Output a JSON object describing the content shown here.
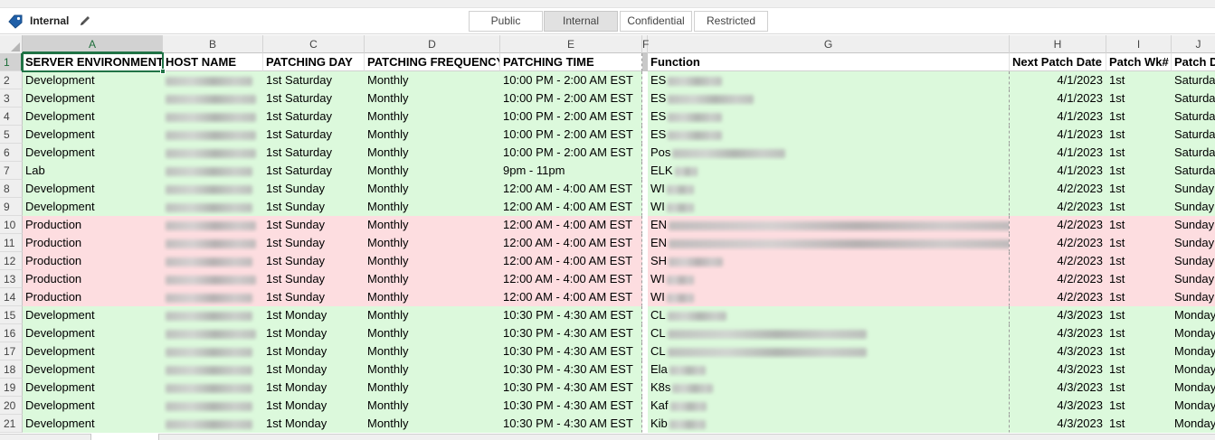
{
  "sensitivity": {
    "current_label": "Internal",
    "icon": "tag-icon",
    "edit_icon": "pencil-icon",
    "options": [
      "Public",
      "Internal",
      "Confidential",
      "Restricted"
    ],
    "selected": "Internal",
    "accent_color": "#1f5fa8"
  },
  "sheet": {
    "selected_cell": "A1",
    "columns": [
      "A",
      "B",
      "C",
      "D",
      "E",
      "F",
      "G",
      "H",
      "I",
      "J"
    ],
    "row_numbers": [
      "1",
      "2",
      "3",
      "4",
      "5",
      "6",
      "7",
      "8",
      "9",
      "10",
      "11",
      "12",
      "13",
      "14",
      "15",
      "16",
      "17",
      "18",
      "19",
      "20",
      "21"
    ],
    "headers": [
      "SERVER ENVIRONMENT",
      "HOST NAME",
      "PATCHING DAY",
      "PATCHING FREQUENCY",
      "PATCHING TIME",
      "",
      "Function",
      "Next Patch Date",
      "Patch Wk#",
      "Patch D"
    ],
    "row_colors": {
      "green": "#dcf9dc",
      "red": "#fddde0"
    },
    "rows": [
      {
        "env": "Development",
        "day": "1st Saturday",
        "freq": "Monthly",
        "time": "10:00 PM - 2:00 AM EST",
        "func": "ES",
        "date": "4/1/2023",
        "wk": "1st",
        "pday": "Saturda",
        "color": "green"
      },
      {
        "env": "Development",
        "day": "1st Saturday",
        "freq": "Monthly",
        "time": "10:00 PM - 2:00 AM EST",
        "func": "ES",
        "date": "4/1/2023",
        "wk": "1st",
        "pday": "Saturda",
        "color": "green"
      },
      {
        "env": "Development",
        "day": "1st Saturday",
        "freq": "Monthly",
        "time": "10:00 PM - 2:00 AM EST",
        "func": "ES",
        "date": "4/1/2023",
        "wk": "1st",
        "pday": "Saturda",
        "color": "green"
      },
      {
        "env": "Development",
        "day": "1st Saturday",
        "freq": "Monthly",
        "time": "10:00 PM - 2:00 AM EST",
        "func": "ES",
        "date": "4/1/2023",
        "wk": "1st",
        "pday": "Saturda",
        "color": "green"
      },
      {
        "env": "Development",
        "day": "1st Saturday",
        "freq": "Monthly",
        "time": "10:00 PM - 2:00 AM EST",
        "func": "Pos",
        "date": "4/1/2023",
        "wk": "1st",
        "pday": "Saturda",
        "color": "green"
      },
      {
        "env": "Lab",
        "day": "1st Saturday",
        "freq": "Monthly",
        "time": "9pm - 11pm",
        "func": "ELK",
        "date": "4/1/2023",
        "wk": "1st",
        "pday": "Saturda",
        "color": "green"
      },
      {
        "env": "Development",
        "day": "1st Sunday",
        "freq": "Monthly",
        "time": "12:00 AM - 4:00 AM EST",
        "func": "WI",
        "date": "4/2/2023",
        "wk": "1st",
        "pday": "Sunday",
        "color": "green"
      },
      {
        "env": "Development",
        "day": "1st Sunday",
        "freq": "Monthly",
        "time": "12:00 AM - 4:00 AM EST",
        "func": "WI",
        "date": "4/2/2023",
        "wk": "1st",
        "pday": "Sunday",
        "color": "green"
      },
      {
        "env": "Production",
        "day": "1st Sunday",
        "freq": "Monthly",
        "time": "12:00 AM - 4:00 AM EST",
        "func": "EN",
        "date": "4/2/2023",
        "wk": "1st",
        "pday": "Sunday",
        "color": "red"
      },
      {
        "env": "Production",
        "day": "1st Sunday",
        "freq": "Monthly",
        "time": "12:00 AM - 4:00 AM EST",
        "func": "EN",
        "date": "4/2/2023",
        "wk": "1st",
        "pday": "Sunday",
        "color": "red"
      },
      {
        "env": "Production",
        "day": "1st Sunday",
        "freq": "Monthly",
        "time": "12:00 AM - 4:00 AM EST",
        "func": "SH",
        "date": "4/2/2023",
        "wk": "1st",
        "pday": "Sunday",
        "color": "red"
      },
      {
        "env": "Production",
        "day": "1st Sunday",
        "freq": "Monthly",
        "time": "12:00 AM - 4:00 AM EST",
        "func": "WI",
        "date": "4/2/2023",
        "wk": "1st",
        "pday": "Sunday",
        "color": "red"
      },
      {
        "env": "Production",
        "day": "1st Sunday",
        "freq": "Monthly",
        "time": "12:00 AM - 4:00 AM EST",
        "func": "WI",
        "date": "4/2/2023",
        "wk": "1st",
        "pday": "Sunday",
        "color": "red"
      },
      {
        "env": "Development",
        "day": "1st Monday",
        "freq": "Monthly",
        "time": "10:30 PM - 4:30 AM EST",
        "func": "CL",
        "date": "4/3/2023",
        "wk": "1st",
        "pday": "Monday",
        "color": "green"
      },
      {
        "env": "Development",
        "day": "1st Monday",
        "freq": "Monthly",
        "time": "10:30 PM - 4:30 AM EST",
        "func": "CL",
        "date": "4/3/2023",
        "wk": "1st",
        "pday": "Monday",
        "color": "green"
      },
      {
        "env": "Development",
        "day": "1st Monday",
        "freq": "Monthly",
        "time": "10:30 PM - 4:30 AM EST",
        "func": "CL",
        "date": "4/3/2023",
        "wk": "1st",
        "pday": "Monday",
        "color": "green"
      },
      {
        "env": "Development",
        "day": "1st Monday",
        "freq": "Monthly",
        "time": "10:30 PM - 4:30 AM EST",
        "func": "Ela",
        "date": "4/3/2023",
        "wk": "1st",
        "pday": "Monday",
        "color": "green"
      },
      {
        "env": "Development",
        "day": "1st Monday",
        "freq": "Monthly",
        "time": "10:30 PM - 4:30 AM EST",
        "func": "K8s",
        "date": "4/3/2023",
        "wk": "1st",
        "pday": "Monday",
        "color": "green"
      },
      {
        "env": "Development",
        "day": "1st Monday",
        "freq": "Monthly",
        "time": "10:30 PM - 4:30 AM EST",
        "func": "Kaf",
        "date": "4/3/2023",
        "wk": "1st",
        "pday": "Monday",
        "color": "green"
      },
      {
        "env": "Development",
        "day": "1st Monday",
        "freq": "Monthly",
        "time": "10:30 PM - 4:30 AM EST",
        "func": "Kib",
        "date": "4/3/2023",
        "wk": "1st",
        "pday": "Monday",
        "color": "green"
      }
    ]
  }
}
